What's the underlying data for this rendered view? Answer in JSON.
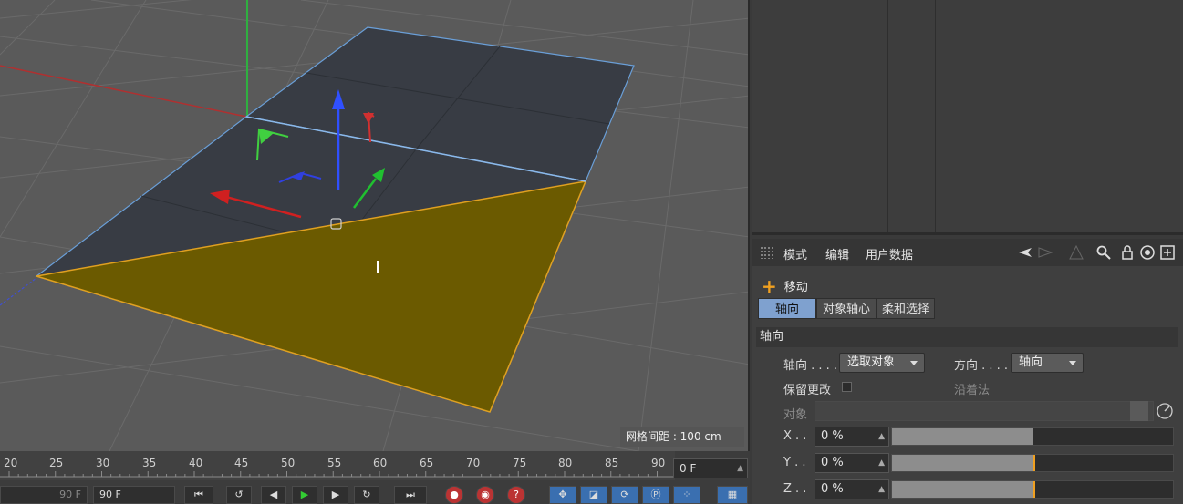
{
  "viewport": {
    "grid_spacing_label": "网格间距 : 100 cm"
  },
  "timeline": {
    "ticks": [
      "20",
      "25",
      "30",
      "35",
      "40",
      "45",
      "50",
      "55",
      "60",
      "65",
      "70",
      "75",
      "80",
      "85",
      "90"
    ],
    "current_frame": "0 F",
    "start_field": "90 F",
    "end_field": "90 F"
  },
  "attributes": {
    "menu": [
      "模式",
      "编辑",
      "用户数据"
    ],
    "tool_name": "移动",
    "tabs": [
      "轴向",
      "对象轴心",
      "柔和选择"
    ],
    "section": "轴向",
    "axis_label": "轴向 . . . .",
    "axis_value": "选取对象",
    "direction_label": "方向 . . . .",
    "direction_value": "轴向",
    "keep_changes_label": "保留更改",
    "along_normal_label": "沿着法",
    "object_label": "对象",
    "x_label": "X . .",
    "x_value": "0 %",
    "y_label": "Y . .",
    "y_value": "0 %",
    "z_label": "Z . .",
    "z_value": "0 %"
  },
  "colors": {
    "selection_fill": "#6b5a00",
    "selection_edge": "#e0a020",
    "polygon_fill": "#383c44",
    "edge_blue": "#6a9fd8",
    "tab_active": "#7fa1cf",
    "accent": "#f0a020"
  }
}
